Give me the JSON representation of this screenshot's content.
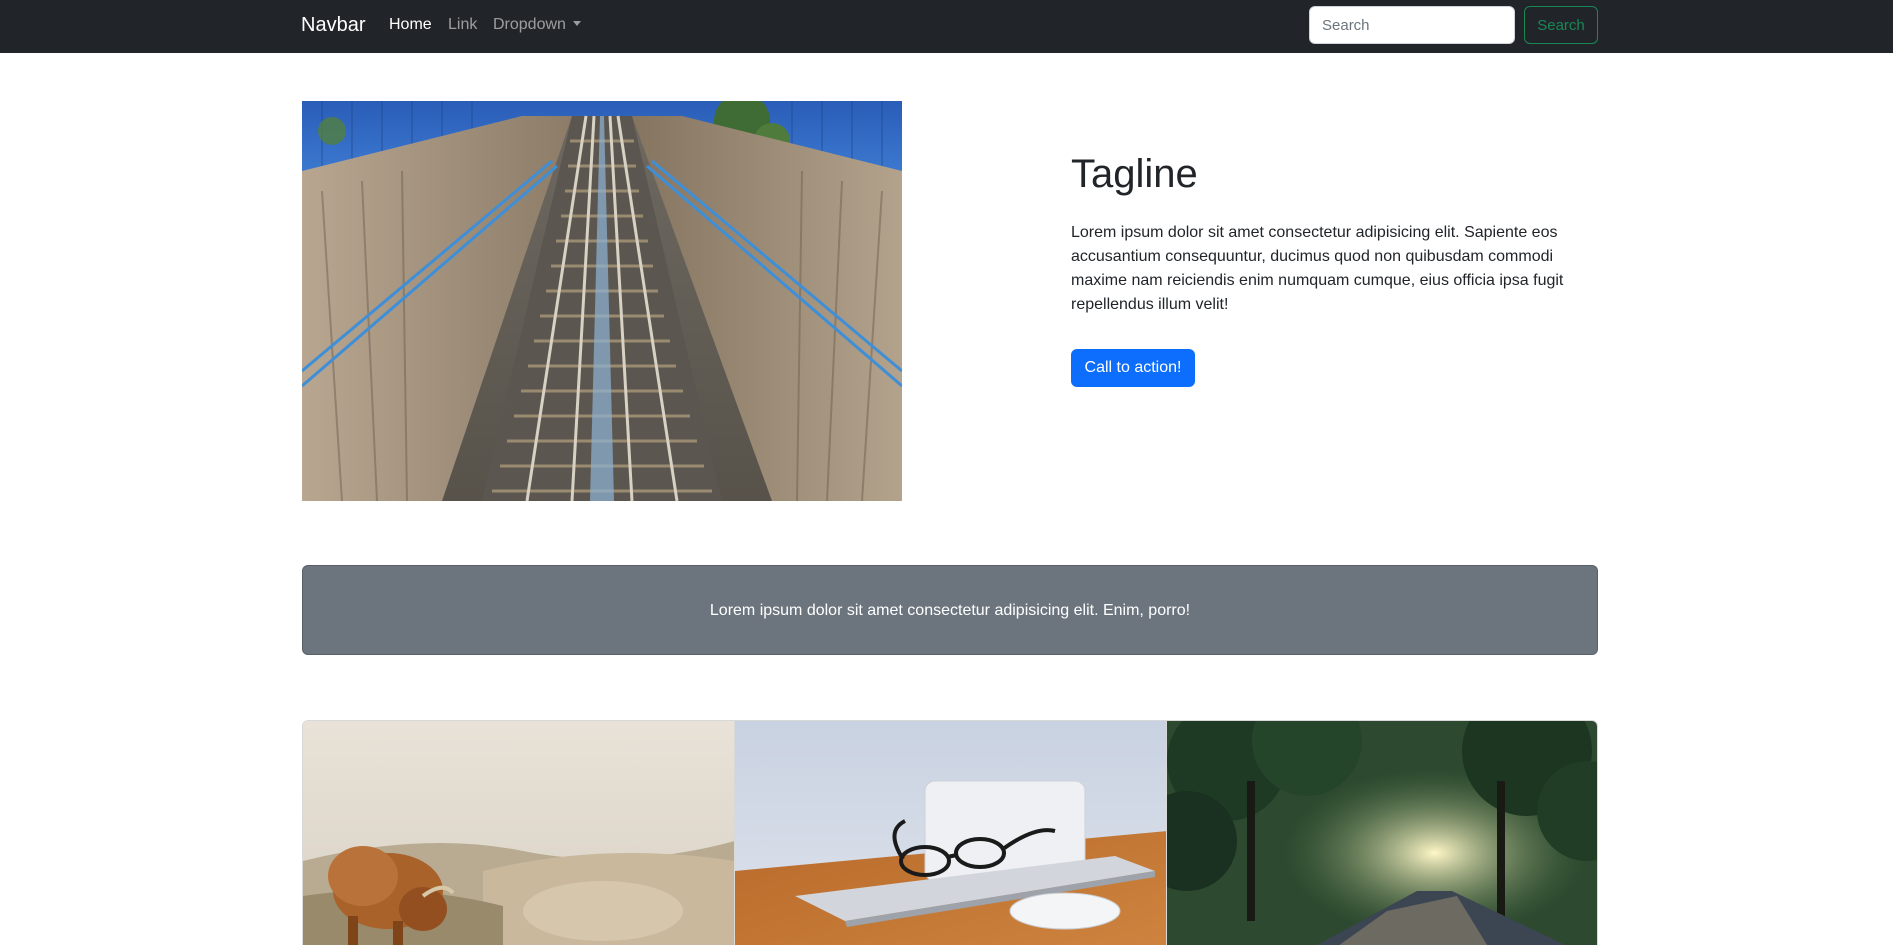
{
  "navbar": {
    "brand": "Navbar",
    "links": [
      {
        "label": "Home"
      },
      {
        "label": "Link"
      },
      {
        "label": "Dropdown"
      }
    ],
    "search_placeholder": "Search",
    "search_button": "Search"
  },
  "hero": {
    "title": "Tagline",
    "text": "Lorem ipsum dolor sit amet consectetur adipisicing elit. Sapiente eos accusantium consequuntur, ducimus quod non quibusdam commodi maxime nam reiciendis enim numquam cumque, eius officia ipsa fugit repellendus illum velit!",
    "cta_label": "Call to action!"
  },
  "banner": {
    "text": "Lorem ipsum dolor sit amet consectetur adipisicing elit. Enim, porro!"
  },
  "colors": {
    "navbar_bg": "#212529",
    "primary": "#0d6efd",
    "success": "#198754",
    "secondary": "#6c757d"
  }
}
